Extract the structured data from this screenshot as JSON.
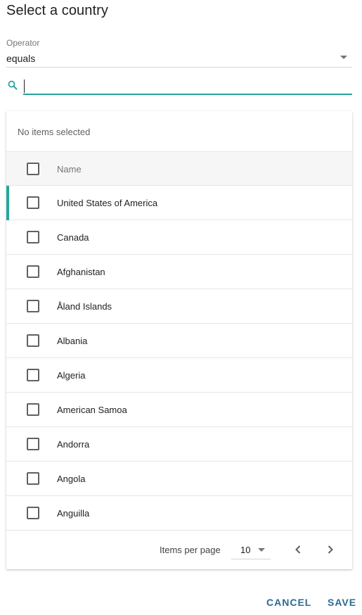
{
  "dialog": {
    "title": "Select a country"
  },
  "operator": {
    "label": "Operator",
    "value": "equals"
  },
  "search": {
    "value": "",
    "icon": "search-icon",
    "accent": "#26a69a"
  },
  "table": {
    "selection_status": "No items selected",
    "header": {
      "name": "Name"
    },
    "rows": [
      {
        "name": "United States of America",
        "selected": false,
        "active": true
      },
      {
        "name": "Canada",
        "selected": false,
        "active": false
      },
      {
        "name": "Afghanistan",
        "selected": false,
        "active": false
      },
      {
        "name": "Åland Islands",
        "selected": false,
        "active": false
      },
      {
        "name": "Albania",
        "selected": false,
        "active": false
      },
      {
        "name": "Algeria",
        "selected": false,
        "active": false
      },
      {
        "name": "American Samoa",
        "selected": false,
        "active": false
      },
      {
        "name": "Andorra",
        "selected": false,
        "active": false
      },
      {
        "name": "Angola",
        "selected": false,
        "active": false
      },
      {
        "name": "Anguilla",
        "selected": false,
        "active": false
      }
    ]
  },
  "pagination": {
    "items_per_page_label": "Items per page",
    "items_per_page": "10",
    "prev_icon": "chevron-left-icon",
    "next_icon": "chevron-right-icon"
  },
  "actions": {
    "cancel": "CANCEL",
    "save": "SAVE"
  },
  "colors": {
    "accent": "#26a69a",
    "action_text": "#2d6a93"
  }
}
